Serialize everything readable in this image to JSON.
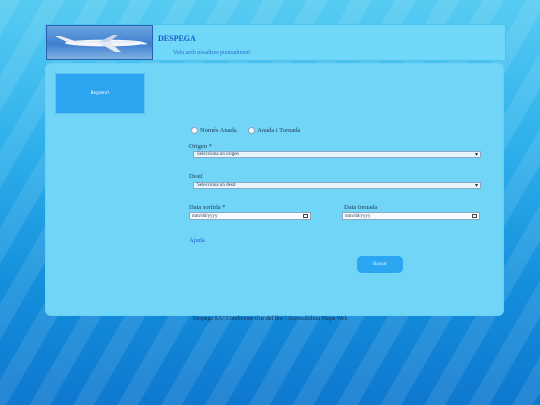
{
  "header": {
    "brand": "DESPEGA",
    "slogan": "Vola amb nosaltres puntualment"
  },
  "sidebar": {
    "register_label": "Registra't"
  },
  "form": {
    "trip_type": {
      "options": [
        "Només Anada",
        "Anada i Tornada"
      ]
    },
    "origin": {
      "label": "Origen *",
      "placeholder": "Selecciona un origen"
    },
    "destination": {
      "label": "Destí",
      "placeholder": "Selecciona un destí"
    },
    "departure": {
      "label": "Data sortida *",
      "placeholder": "mm/dd/yyyy"
    },
    "return": {
      "label": "Data tornada",
      "placeholder": "mm/dd/yyyy"
    },
    "help_link": "Ajuda",
    "search_button": "Buscar"
  },
  "footer": {
    "text": "Despega SA | Condicions d'us del lloc | Accessibilitat Mapa Web"
  }
}
